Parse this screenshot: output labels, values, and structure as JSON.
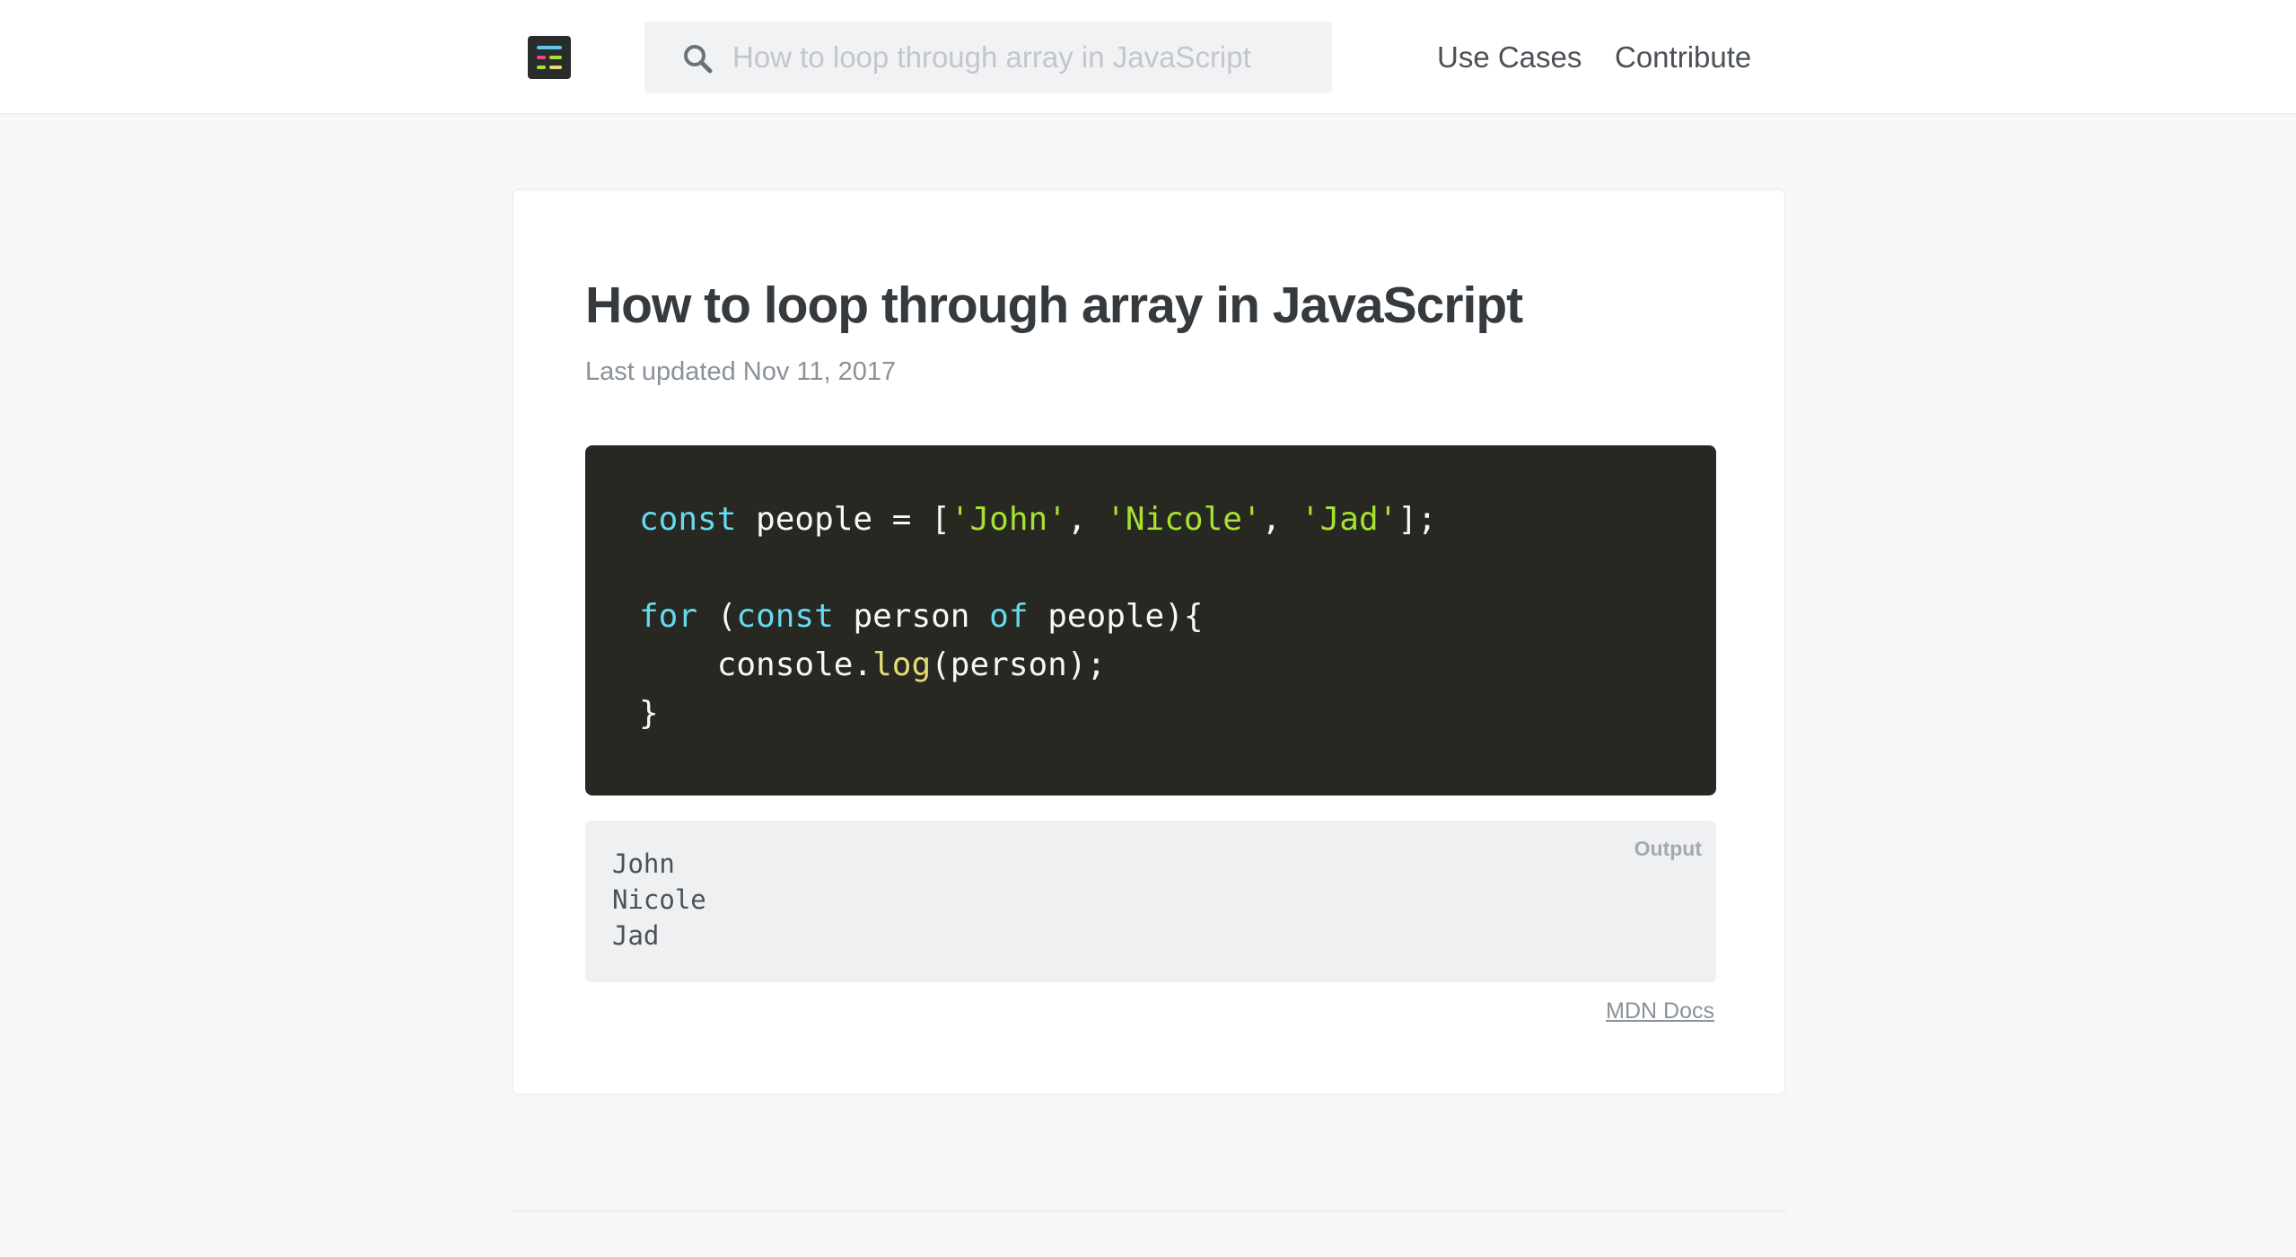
{
  "header": {
    "search": {
      "placeholder": "How to loop through array in JavaScript"
    },
    "nav": {
      "use_cases": "Use Cases",
      "contribute": "Contribute"
    }
  },
  "article": {
    "title": "How to loop through array in JavaScript",
    "updated": "Last updated Nov 11, 2017",
    "code": {
      "line1": {
        "kw": "const",
        "a": " people = [",
        "s1": "'John'",
        "c1": ", ",
        "s2": "'Nicole'",
        "c2": ", ",
        "s3": "'Jad'",
        "end": "];"
      },
      "line3": {
        "kw1": "for",
        "a": " (",
        "kw2": "const",
        "b": " person ",
        "kw3": "of",
        "c": " people){"
      },
      "line4": {
        "a": "    console.",
        "fn": "log",
        "b": "(person);"
      },
      "line5": "}"
    },
    "output": {
      "label": "Output",
      "lines": [
        "John",
        "Nicole",
        "Jad"
      ]
    },
    "docs_link": "MDN Docs"
  },
  "colors": {
    "code_bg": "#272822",
    "keyword": "#66d9ef",
    "string": "#a6e22e",
    "function": "#e6db74"
  }
}
